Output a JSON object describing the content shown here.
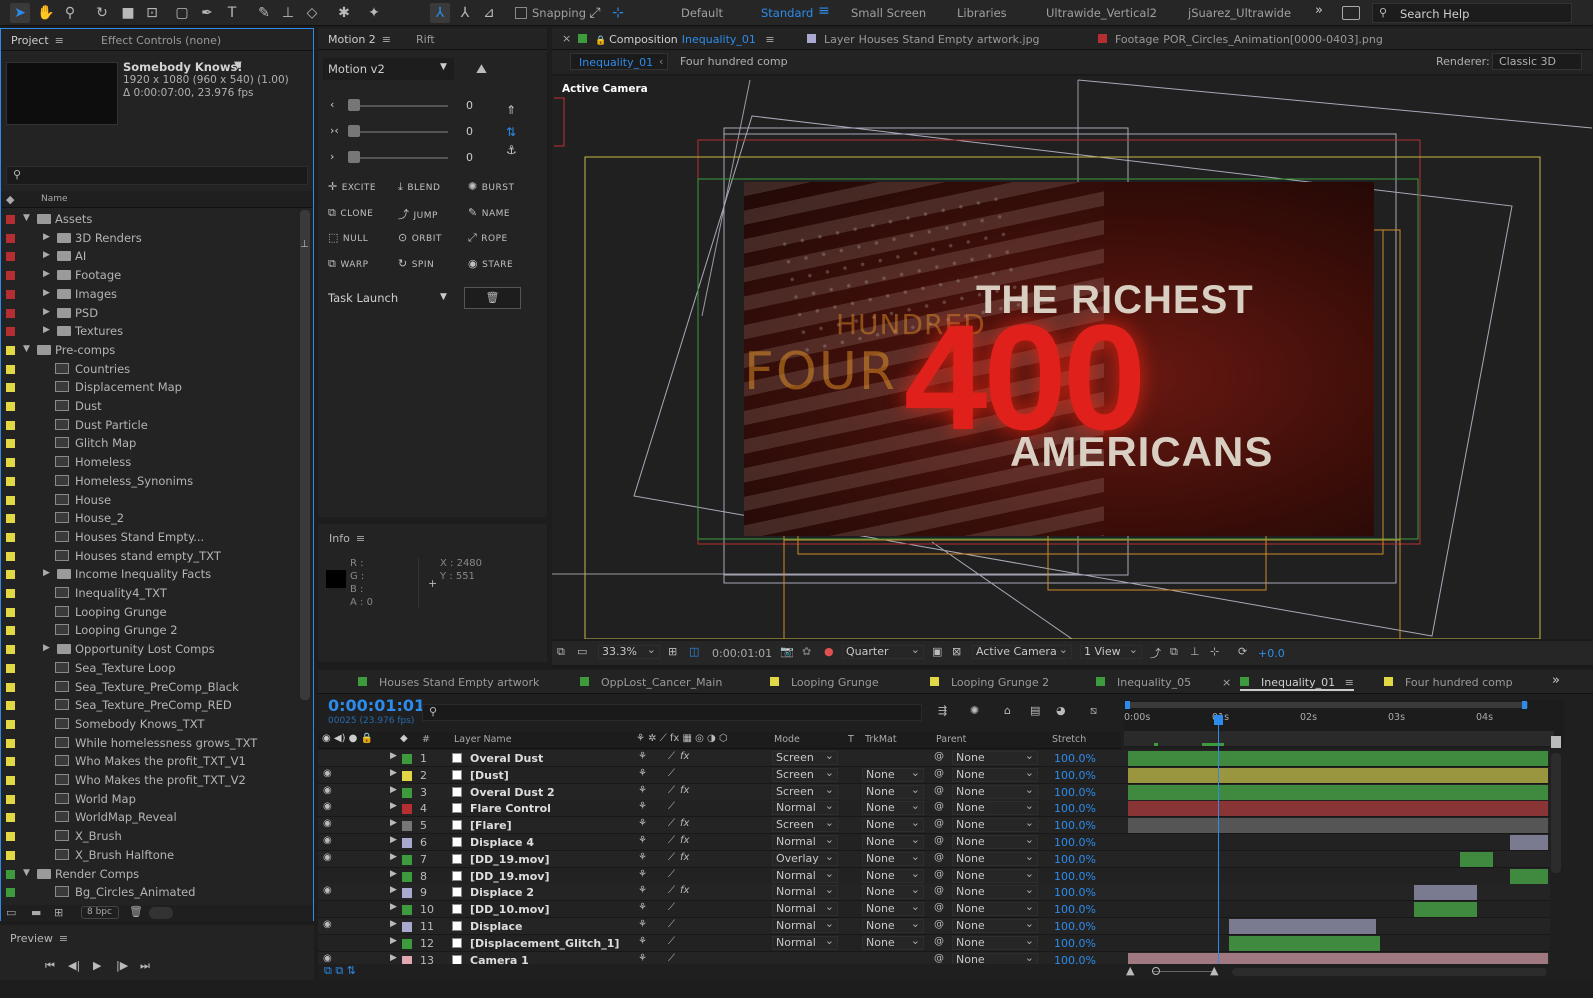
{
  "toolbar": {
    "snapping_label": "Snapping",
    "workspaces": [
      "Default",
      "Standard",
      "Small Screen",
      "Libraries",
      "Ultrawide_Vertical2",
      "jSuarez_Ultrawide"
    ],
    "active_workspace": "Standard",
    "search_placeholder": "Search Help"
  },
  "project_panel": {
    "tab_project": "Project",
    "tab_effect_controls": "Effect Controls (none)",
    "item_name": "Somebody Knows!",
    "item_dims": "1920 x 1080  (960 x 540) (1.00)",
    "item_duration": "Δ 0:00:07:00, 23.976 fps",
    "column_name": "Name",
    "bpc": "8 bpc",
    "rows": [
      {
        "label": "Assets",
        "type": "folder",
        "indent": 0,
        "open": true,
        "color": "#b52e31"
      },
      {
        "label": "3D Renders",
        "type": "folder",
        "indent": 1,
        "open": false,
        "color": "#b52e31"
      },
      {
        "label": "AI",
        "type": "folder",
        "indent": 1,
        "open": false,
        "color": "#b52e31"
      },
      {
        "label": "Footage",
        "type": "folder",
        "indent": 1,
        "open": false,
        "color": "#b52e31"
      },
      {
        "label": "Images",
        "type": "folder",
        "indent": 1,
        "open": false,
        "color": "#b52e31"
      },
      {
        "label": "PSD",
        "type": "folder",
        "indent": 1,
        "open": false,
        "color": "#b52e31"
      },
      {
        "label": "Textures",
        "type": "folder",
        "indent": 1,
        "open": false,
        "color": "#b52e31"
      },
      {
        "label": "Pre-comps",
        "type": "folder",
        "indent": 0,
        "open": true,
        "color": "#e2d845"
      },
      {
        "label": "Countries",
        "type": "comp",
        "indent": 1,
        "color": "#e2d845"
      },
      {
        "label": "Displacement Map",
        "type": "comp",
        "indent": 1,
        "color": "#e2d845"
      },
      {
        "label": "Dust",
        "type": "comp",
        "indent": 1,
        "color": "#e2d845"
      },
      {
        "label": "Dust Particle",
        "type": "comp",
        "indent": 1,
        "color": "#e2d845"
      },
      {
        "label": "Glitch Map",
        "type": "comp",
        "indent": 1,
        "color": "#e2d845"
      },
      {
        "label": "Homeless",
        "type": "comp",
        "indent": 1,
        "color": "#e2d845"
      },
      {
        "label": "Homeless_Synonims",
        "type": "comp",
        "indent": 1,
        "color": "#e2d845"
      },
      {
        "label": "House",
        "type": "comp",
        "indent": 1,
        "color": "#e2d845"
      },
      {
        "label": "House_2",
        "type": "comp",
        "indent": 1,
        "color": "#e2d845"
      },
      {
        "label": "Houses Stand Empty...",
        "type": "comp",
        "indent": 1,
        "color": "#e2d845"
      },
      {
        "label": "Houses stand empty_TXT",
        "type": "comp",
        "indent": 1,
        "color": "#e2d845"
      },
      {
        "label": "Income Inequality Facts",
        "type": "folder",
        "indent": 1,
        "open": false,
        "color": "#e2d845"
      },
      {
        "label": "Inequality4_TXT",
        "type": "comp",
        "indent": 1,
        "color": "#e2d845"
      },
      {
        "label": "Looping Grunge",
        "type": "comp",
        "indent": 1,
        "color": "#e2d845"
      },
      {
        "label": "Looping Grunge 2",
        "type": "comp",
        "indent": 1,
        "color": "#e2d845"
      },
      {
        "label": "Opportunity Lost Comps",
        "type": "folder",
        "indent": 1,
        "open": false,
        "color": "#e2d845"
      },
      {
        "label": "Sea_Texture Loop",
        "type": "comp",
        "indent": 1,
        "color": "#e2d845"
      },
      {
        "label": "Sea_Texture_PreComp_Black",
        "type": "comp",
        "indent": 1,
        "color": "#e2d845"
      },
      {
        "label": "Sea_Texture_PreComp_RED",
        "type": "comp",
        "indent": 1,
        "color": "#e2d845"
      },
      {
        "label": "Somebody Knows_TXT",
        "type": "comp",
        "indent": 1,
        "color": "#e2d845"
      },
      {
        "label": "While homelessness grows_TXT",
        "type": "comp",
        "indent": 1,
        "color": "#e2d845"
      },
      {
        "label": "Who Makes the profit_TXT_V1",
        "type": "comp",
        "indent": 1,
        "color": "#e2d845"
      },
      {
        "label": "Who Makes the profit_TXT_V2",
        "type": "comp",
        "indent": 1,
        "color": "#e2d845"
      },
      {
        "label": "World Map",
        "type": "comp",
        "indent": 1,
        "color": "#e2d845"
      },
      {
        "label": "WorldMap_Reveal",
        "type": "comp",
        "indent": 1,
        "color": "#e2d845"
      },
      {
        "label": "X_Brush",
        "type": "comp",
        "indent": 1,
        "color": "#e2d845"
      },
      {
        "label": "X_Brush Halftone",
        "type": "comp",
        "indent": 1,
        "color": "#e2d845"
      },
      {
        "label": "Render Comps",
        "type": "folder",
        "indent": 0,
        "open": true,
        "color": "#3d9a3d"
      },
      {
        "label": "Bg_Circles_Animated",
        "type": "comp",
        "indent": 1,
        "color": "#3d9a3d"
      }
    ]
  },
  "preview": {
    "title": "Preview"
  },
  "motion_panel": {
    "tab_motion": "Motion 2",
    "tab_rift": "Rift",
    "preset": "Motion v2",
    "sliders": [
      "0",
      "0",
      "0"
    ],
    "buttons": [
      "EXCITE",
      "BLEND",
      "BURST",
      "CLONE",
      "JUMP",
      "NAME",
      "NULL",
      "ORBIT",
      "ROPE",
      "WARP",
      "SPIN",
      "STARE"
    ],
    "task": "Task Launch"
  },
  "info_panel": {
    "title": "Info",
    "r": "R :",
    "g": "G :",
    "b": "B :",
    "a": "A : 0",
    "x": "X : 2480",
    "y": "Y : 551"
  },
  "composition": {
    "tabs": [
      {
        "prefix": "Composition",
        "name": "Inequality_01",
        "color": "#3d9a3d"
      },
      {
        "prefix": "Layer",
        "name": "Houses Stand Empty artwork.jpg",
        "color": "#a9a9cf"
      },
      {
        "prefix": "Footage",
        "name": "POR_Circles_Animation[0000-0403].png",
        "color": "#b52e31"
      }
    ],
    "breadcrumb_active": "Inequality_01",
    "breadcrumb_next": "Four hundred comp",
    "renderer_label": "Renderer:",
    "renderer_value": "Classic 3D",
    "active_camera": "Active Camera",
    "art_text": {
      "line1": "THE RICHEST",
      "big": "400",
      "line3": "AMERICANS",
      "ghost1": "HUNDRED",
      "ghost2": "FOUR"
    },
    "zoom": "33.3%",
    "timecode": "0:00:01:01",
    "resolution": "Quarter",
    "camera_view": "Active Camera",
    "view_count": "1 View",
    "exposure": "+0.0"
  },
  "timeline": {
    "tabs": [
      {
        "name": "Houses Stand Empty artwork",
        "color": "#3d9a3d"
      },
      {
        "name": "OppLost_Cancer_Main",
        "color": "#3d9a3d"
      },
      {
        "name": "Looping Grunge",
        "color": "#e2d845"
      },
      {
        "name": "Looping Grunge 2",
        "color": "#e2d845"
      },
      {
        "name": "Inequality_05",
        "color": "#3d9a3d"
      },
      {
        "name": "Inequality_01",
        "color": "#3d9a3d"
      },
      {
        "name": "Four hundred comp",
        "color": "#e2d845"
      }
    ],
    "active_tab": "Inequality_01",
    "current_time": "0:00:01:01",
    "frame_info": "00025 (23.976 fps)",
    "columns": {
      "num": "#",
      "layer_name": "Layer Name",
      "mode": "Mode",
      "t": "T",
      "trkmat": "TrkMat",
      "parent": "Parent",
      "stretch": "Stretch"
    },
    "ruler": [
      "0:00s",
      "01s",
      "02s",
      "03s",
      "04s"
    ],
    "playhead_fraction": 0.22,
    "layers": [
      {
        "num": "1",
        "name": "Overal Dust",
        "color": "#3d9a3d",
        "mode": "Screen",
        "trkmat": "",
        "parent": "None",
        "stretch": "100.0%",
        "bar_start": 0.0,
        "bar_end": 1.0,
        "bar_color": "#3f8a3f",
        "visible": false
      },
      {
        "num": "2",
        "name": "[Dust]",
        "color": "#e2d845",
        "mode": "Screen",
        "trkmat": "None",
        "parent": "None",
        "stretch": "100.0%",
        "bar_start": 0.0,
        "bar_end": 1.0,
        "bar_color": "#9a9640",
        "visible": true
      },
      {
        "num": "3",
        "name": "Overal Dust 2",
        "color": "#3d9a3d",
        "mode": "Screen",
        "trkmat": "None",
        "parent": "None",
        "stretch": "100.0%",
        "bar_start": 0.0,
        "bar_end": 1.0,
        "bar_color": "#3f8a3f",
        "visible": true
      },
      {
        "num": "4",
        "name": "Flare Control",
        "color": "#b52e31",
        "mode": "Normal",
        "trkmat": "None",
        "parent": "None",
        "stretch": "100.0%",
        "bar_start": 0.0,
        "bar_end": 1.0,
        "bar_color": "#8a3535",
        "visible": true
      },
      {
        "num": "5",
        "name": "[Flare]",
        "color": "#777777",
        "mode": "Screen",
        "trkmat": "None",
        "parent": "None",
        "stretch": "100.0%",
        "bar_start": 0.0,
        "bar_end": 1.0,
        "bar_color": "#555555",
        "visible": true
      },
      {
        "num": "6",
        "name": "Displace 4",
        "color": "#a9a9cf",
        "mode": "Normal",
        "trkmat": "None",
        "parent": "None",
        "stretch": "100.0%",
        "bar_start": 0.91,
        "bar_end": 1.0,
        "bar_color": "#7a7a90",
        "visible": true
      },
      {
        "num": "7",
        "name": "[DD_19.mov]",
        "color": "#3d9a3d",
        "mode": "Overlay",
        "trkmat": "None",
        "parent": "None",
        "stretch": "100.0%",
        "bar_start": 0.79,
        "bar_end": 0.87,
        "bar_color": "#3f8a3f",
        "visible": true
      },
      {
        "num": "8",
        "name": "[DD_19.mov]",
        "color": "#3d9a3d",
        "mode": "Normal",
        "trkmat": "None",
        "parent": "None",
        "stretch": "100.0%",
        "bar_start": 0.91,
        "bar_end": 1.0,
        "bar_color": "#3f8a3f",
        "visible": false
      },
      {
        "num": "9",
        "name": "Displace 2",
        "color": "#a9a9cf",
        "mode": "Normal",
        "trkmat": "None",
        "parent": "None",
        "stretch": "100.0%",
        "bar_start": 0.68,
        "bar_end": 0.83,
        "bar_color": "#7a7a90",
        "visible": true
      },
      {
        "num": "10",
        "name": "[DD_10.mov]",
        "color": "#3d9a3d",
        "mode": "Normal",
        "trkmat": "None",
        "parent": "None",
        "stretch": "100.0%",
        "bar_start": 0.68,
        "bar_end": 0.83,
        "bar_color": "#3f8a3f",
        "visible": false
      },
      {
        "num": "11",
        "name": "Displace",
        "color": "#a9a9cf",
        "mode": "Normal",
        "trkmat": "None",
        "parent": "None",
        "stretch": "100.0%",
        "bar_start": 0.24,
        "bar_end": 0.59,
        "bar_color": "#7a7a90",
        "visible": true
      },
      {
        "num": "12",
        "name": "[Displacement_Glitch_1]",
        "color": "#3d9a3d",
        "mode": "Normal",
        "trkmat": "None",
        "parent": "None",
        "stretch": "100.0%",
        "bar_start": 0.24,
        "bar_end": 0.6,
        "bar_color": "#3f8a3f",
        "visible": false
      },
      {
        "num": "13",
        "name": "Camera 1",
        "color": "#e0a9b2",
        "mode": "",
        "trkmat": "",
        "parent": "None",
        "stretch": "100.0%",
        "bar_start": 0.0,
        "bar_end": 1.0,
        "bar_color": "#a07880",
        "visible": true
      }
    ]
  }
}
